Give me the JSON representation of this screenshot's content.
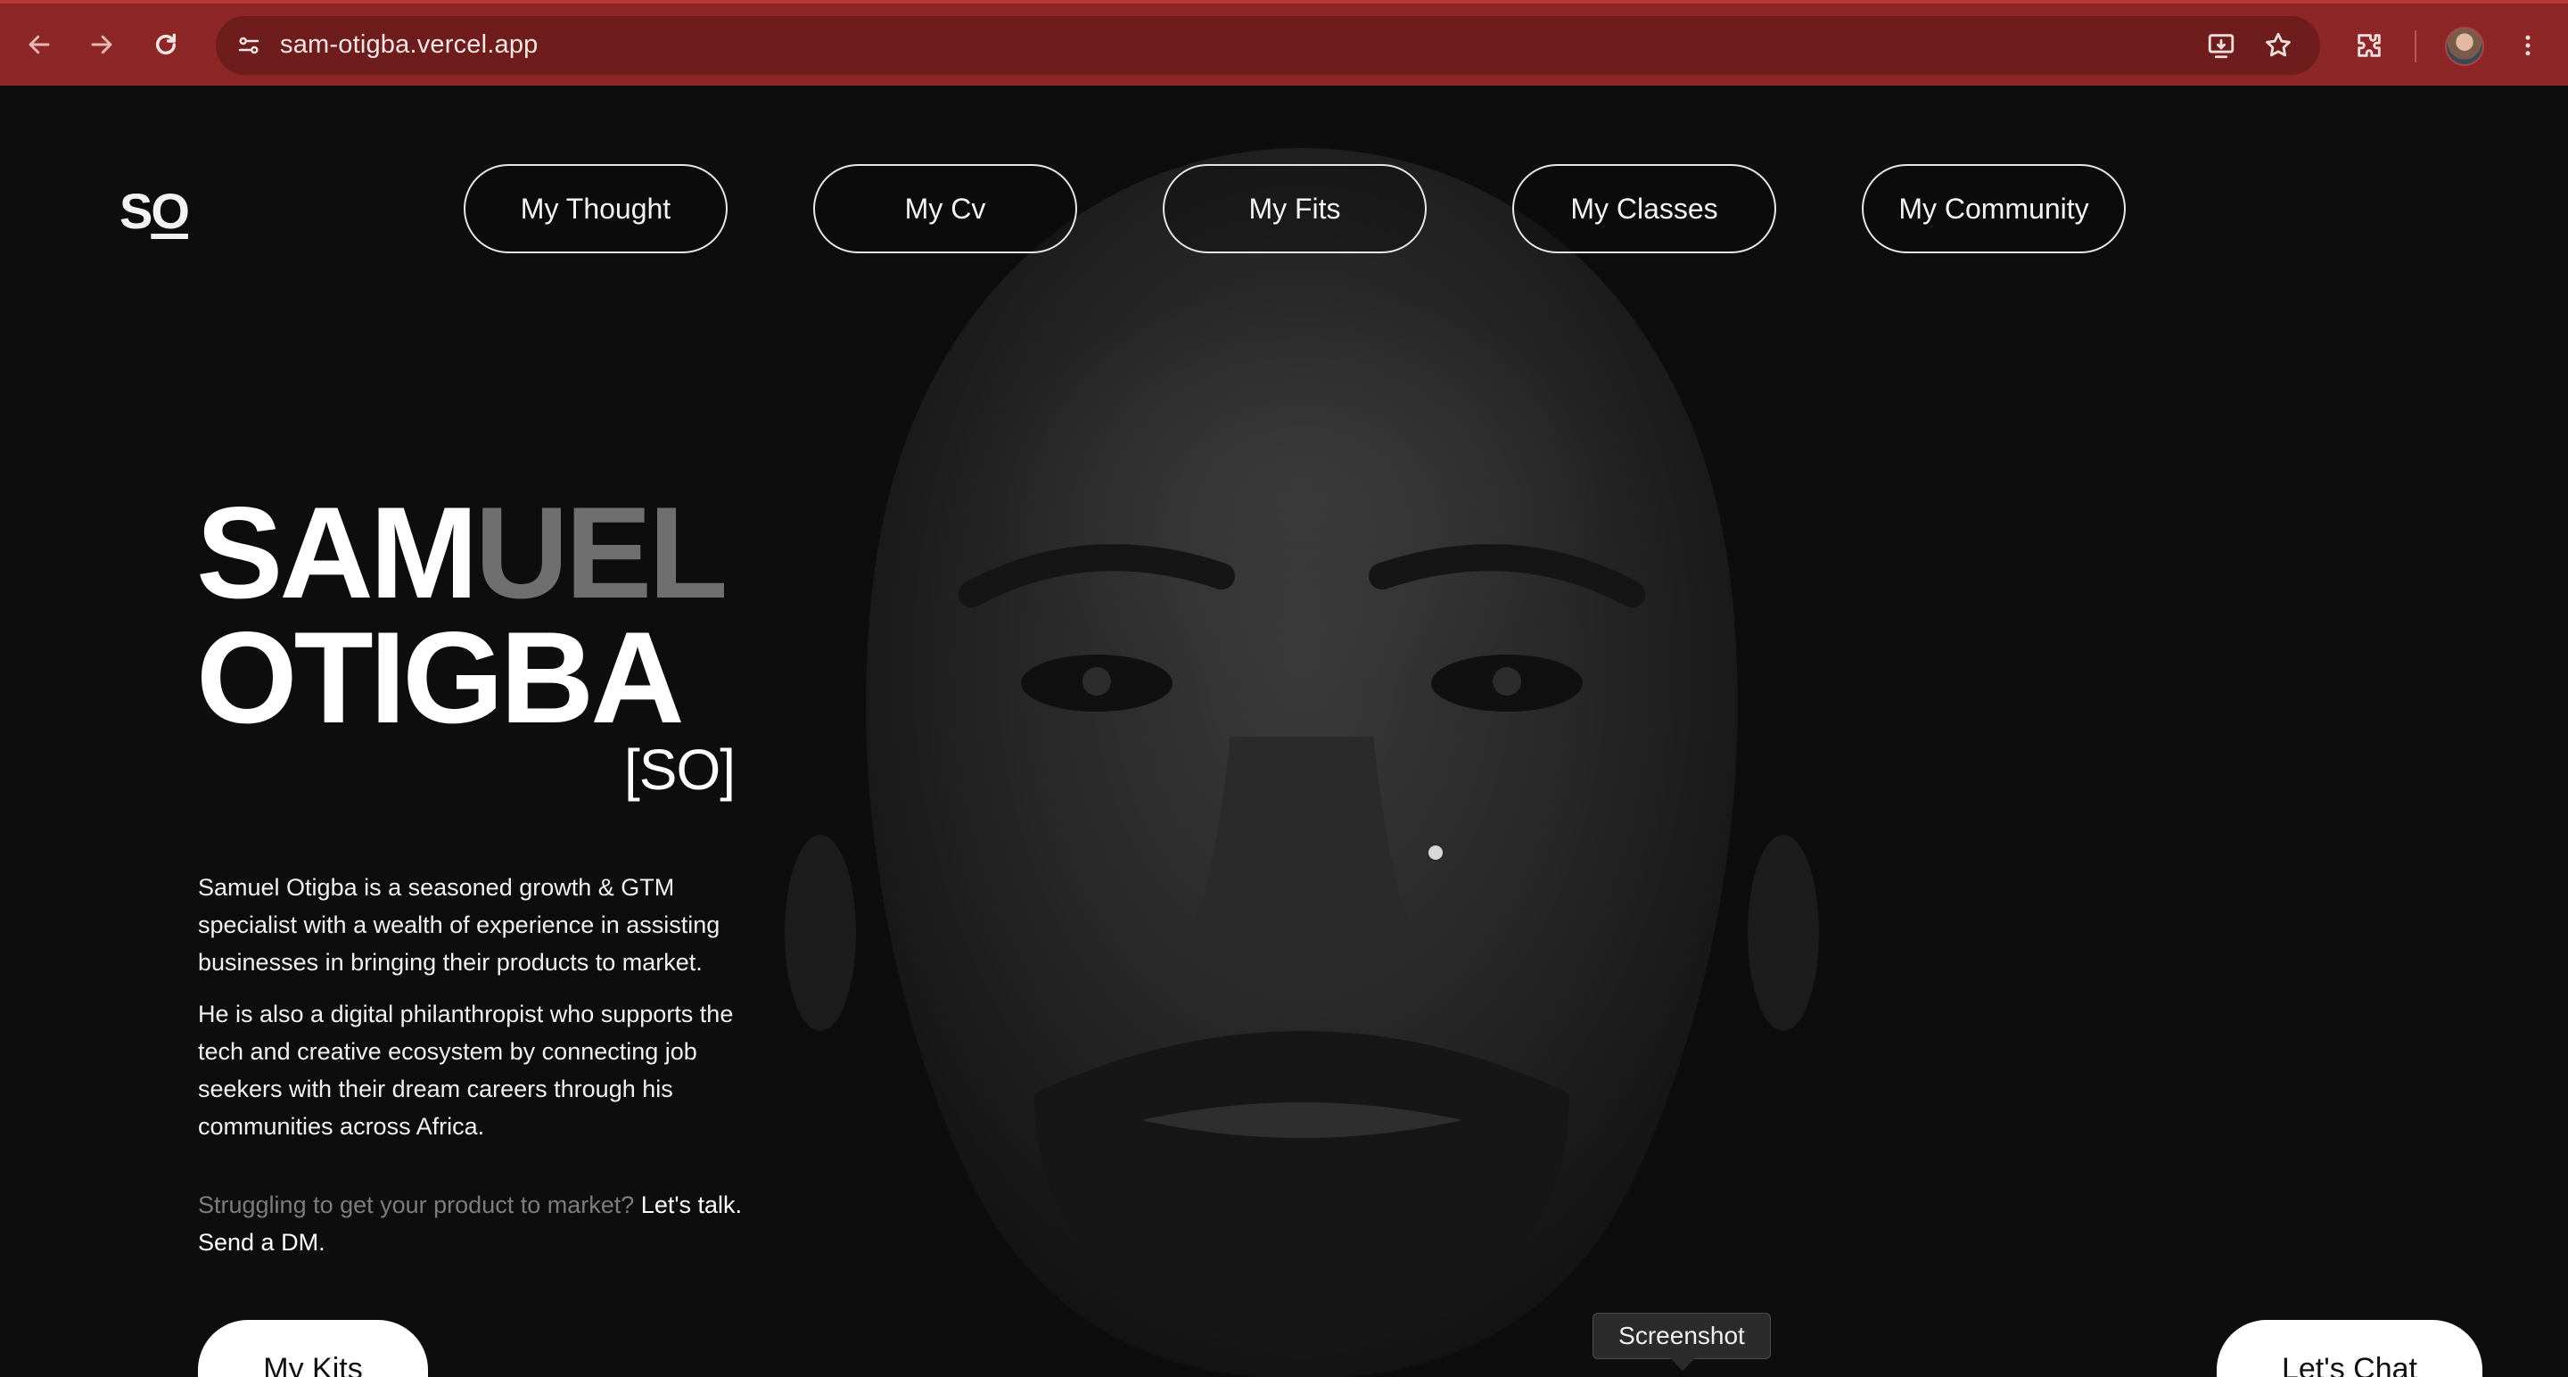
{
  "browser": {
    "url": "sam-otigba.vercel.app",
    "icons": {
      "back": "back-arrow-icon",
      "forward": "forward-arrow-icon",
      "reload": "reload-icon",
      "site_settings": "site-settings-icon",
      "install": "install-app-icon",
      "bookmark": "star-icon",
      "extensions": "puzzle-icon",
      "menu": "kebab-menu-icon"
    },
    "theme_color": "#8d2626"
  },
  "header": {
    "logo": {
      "s": "S",
      "o": "O"
    },
    "nav": [
      {
        "label": "My Thought"
      },
      {
        "label": "My Cv"
      },
      {
        "label": "My Fits"
      },
      {
        "label": "My Classes"
      },
      {
        "label": "My Community"
      }
    ]
  },
  "hero": {
    "name_line1_bright": "SAM",
    "name_line1_dim": "UEL",
    "name_line2": "OTIGBA",
    "tag": "[SO]",
    "bio": [
      "Samuel Otigba is a seasoned growth & GTM specialist with a wealth of experience in assisting businesses in bringing their products to market.",
      "He is also a digital philanthropist who supports the tech and creative ecosystem by connecting job seekers with their dream careers through his communities across Africa."
    ],
    "cta_muted": "Struggling to get your product to market?",
    "cta_strong": "Let's talk. Send a DM."
  },
  "buttons": {
    "kits": "My Kits",
    "chat": "Let's Chat"
  },
  "tooltip": "Screenshot"
}
